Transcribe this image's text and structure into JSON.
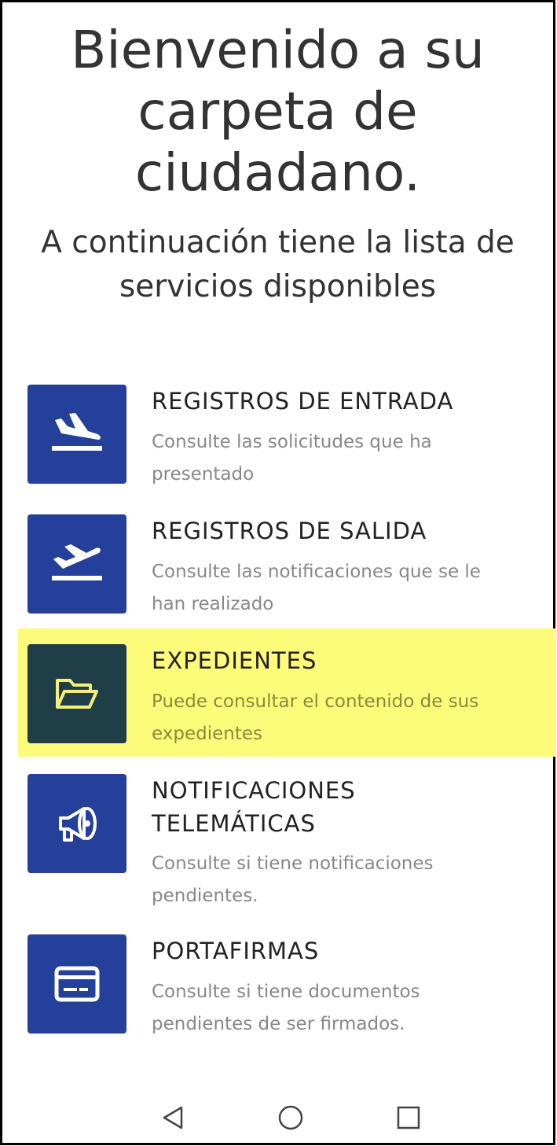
{
  "header": {
    "title_lines": [
      "Bienvenido a su",
      "carpeta de",
      "ciudadano."
    ],
    "subtitle_lines": [
      "A continuación tiene la lista de",
      "servicios disponibles"
    ]
  },
  "services": [
    {
      "title": "REGISTROS DE ENTRADA",
      "description_lines": [
        "Consulte las solicitudes que ha",
        "presentado"
      ],
      "icon": "plane-landing-icon",
      "highlighted": false
    },
    {
      "title": "REGISTROS DE SALIDA",
      "description_lines": [
        "Consulte las notificaciones que se le",
        "han realizado"
      ],
      "icon": "plane-takeoff-icon",
      "highlighted": false
    },
    {
      "title": "EXPEDIENTES",
      "description_lines": [
        "Puede consultar el contenido de sus",
        "expedientes"
      ],
      "icon": "folder-open-icon",
      "highlighted": true
    },
    {
      "title_lines": [
        "NOTIFICACIONES",
        "TELEMÁTICAS"
      ],
      "description_lines": [
        "Consulte si tiene notificaciones",
        "pendientes."
      ],
      "icon": "megaphone-icon",
      "highlighted": false
    },
    {
      "title": "PORTAFIRMAS",
      "description_lines": [
        "Consulte si tiene documentos",
        "pendientes de ser firmados."
      ],
      "icon": "card-icon",
      "highlighted": false
    }
  ],
  "navbar": {
    "buttons": [
      "back-icon",
      "home-icon",
      "recents-icon"
    ]
  },
  "colors": {
    "tile": "#24409a",
    "tile_highlighted": "#203e47",
    "highlight": "#fcfb7a",
    "icon_highlighted": "#f2f07a"
  }
}
